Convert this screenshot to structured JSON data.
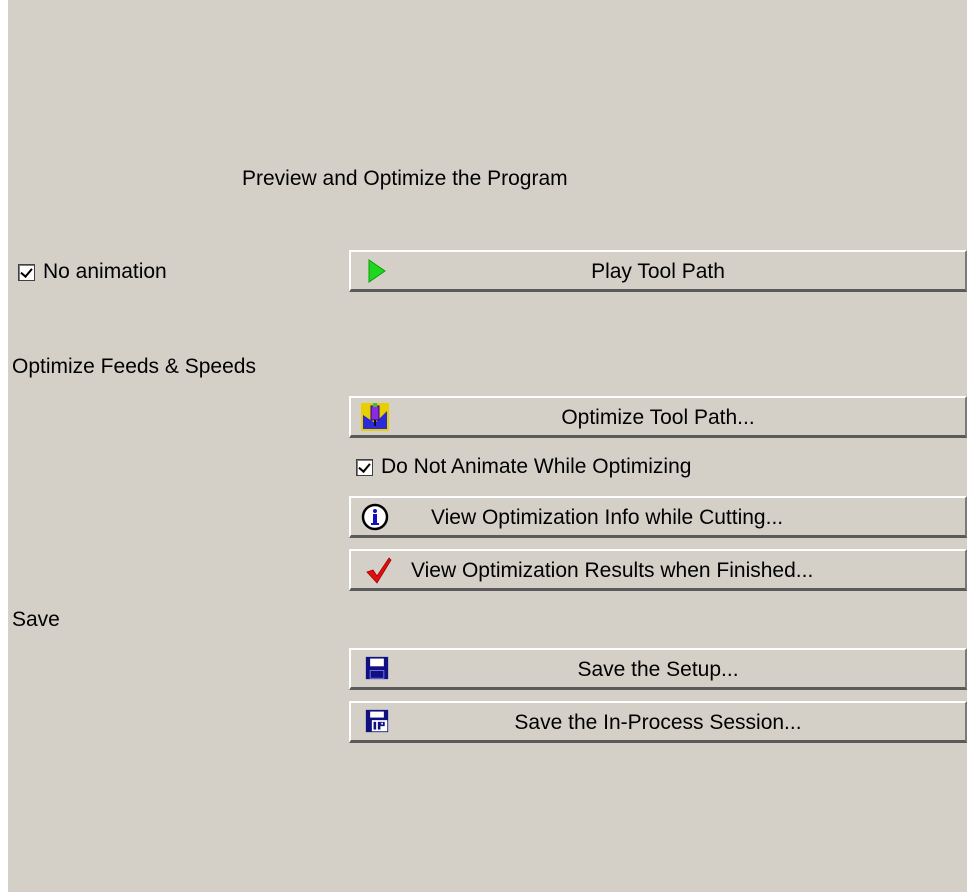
{
  "header": {
    "title": "Preview and Optimize the Program"
  },
  "preview": {
    "no_animation_label": "No animation",
    "no_animation_checked": true,
    "play_button_label": "Play Tool Path",
    "play_icon": "play-icon"
  },
  "optimize": {
    "section_label": "Optimize Feeds & Speeds",
    "optimize_button_label": "Optimize Tool Path...",
    "optimize_icon": "optimize-tool-icon",
    "do_not_animate_label": "Do Not Animate While Optimizing",
    "do_not_animate_checked": true,
    "info_button_label": "View Optimization Info while Cutting...",
    "info_icon": "info-icon",
    "results_button_label": "View Optimization Results when Finished...",
    "results_icon": "checkmark-icon"
  },
  "save": {
    "section_label": "Save",
    "setup_button_label": "Save the Setup...",
    "setup_icon": "floppy-disk-icon",
    "session_button_label": "Save the In-Process Session...",
    "session_icon": "floppy-ip-icon"
  },
  "colors": {
    "panel_background": "#d4d0c8",
    "play_green": "#1ed81e",
    "check_red": "#e01010",
    "floppy_navy": "#101080"
  }
}
